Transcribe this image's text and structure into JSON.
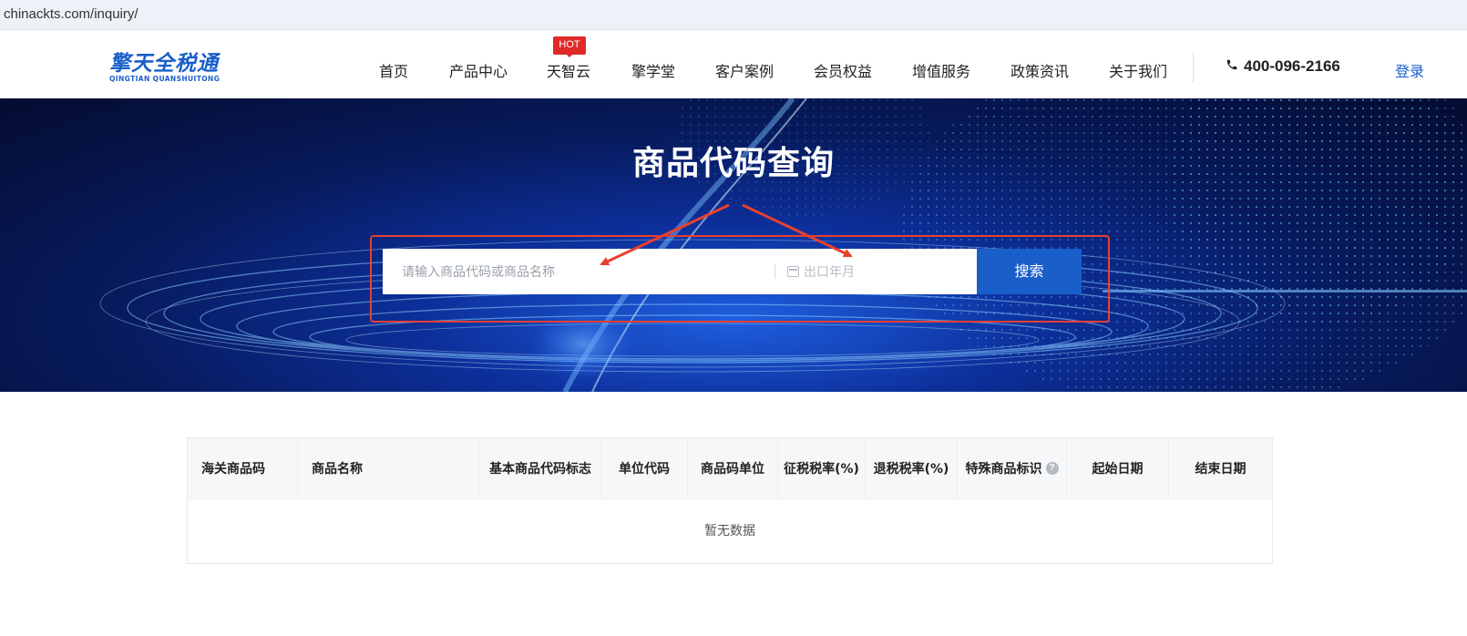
{
  "browser": {
    "url": "chinackts.com/inquiry/"
  },
  "header": {
    "logo_cn": "擎天全税通",
    "logo_en": "QINGTIAN QUANSHUITONG",
    "nav": [
      {
        "label": "首页"
      },
      {
        "label": "产品中心"
      },
      {
        "label": "天智云",
        "badge": "HOT"
      },
      {
        "label": "擎学堂"
      },
      {
        "label": "客户案例"
      },
      {
        "label": "会员权益"
      },
      {
        "label": "增值服务"
      },
      {
        "label": "政策资讯"
      },
      {
        "label": "关于我们"
      }
    ],
    "phone": "400-096-2166",
    "login": "登录"
  },
  "banner": {
    "title": "商品代码查询",
    "search_placeholder": "请输入商品代码或商品名称",
    "month_placeholder": "出口年月",
    "search_button": "搜索"
  },
  "table": {
    "columns": [
      "海关商品码",
      "商品名称",
      "基本商品代码标志",
      "单位代码",
      "商品码单位",
      "征税税率(%)",
      "退税税率(%)",
      "特殊商品标识",
      "起始日期",
      "结束日期"
    ],
    "help_icon_label": "?",
    "empty_text": "暂无数据",
    "rows": []
  },
  "colors": {
    "brand_blue": "#1a5ec9",
    "hot_red": "#e02a2a",
    "annotation_red": "#e8402f"
  }
}
